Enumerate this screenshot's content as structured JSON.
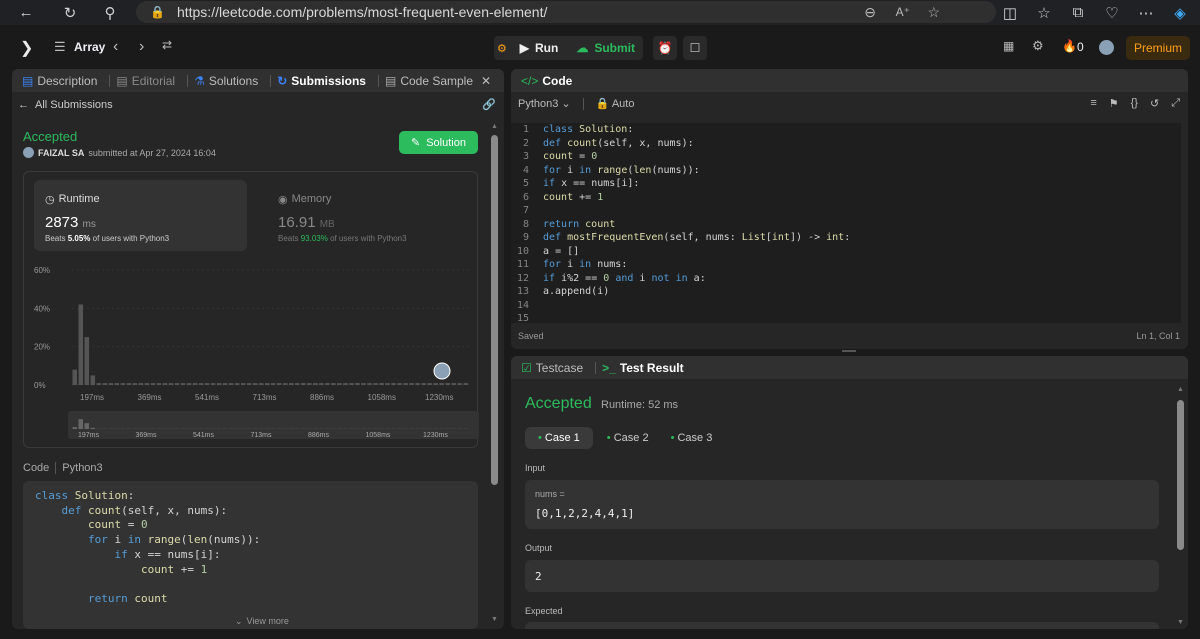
{
  "browser": {
    "url": "https://leetcode.com/problems/most-frequent-even-element/"
  },
  "nav": {
    "problem_list": "Array",
    "run": "Run",
    "submit": "Submit",
    "streak": "0",
    "premium": "Premium"
  },
  "left": {
    "tabs": [
      "Description",
      "Editorial",
      "Solutions",
      "Submissions",
      "Code Sample"
    ],
    "back_label": "All Submissions",
    "status": "Accepted",
    "user": "FAIZAL SA",
    "submitted": "submitted at Apr 27, 2024 16:04",
    "solution_btn": "Solution",
    "runtime": {
      "label": "Runtime",
      "value": "2873",
      "unit": "ms",
      "beats_prefix": "Beats",
      "beats": "5.05%",
      "beats_suffix": "of users with Python3"
    },
    "memory": {
      "label": "Memory",
      "value": "16.91",
      "unit": "MB",
      "beats_prefix": "Beats",
      "beats": "93.03%",
      "beats_suffix": "of users with Python3"
    },
    "code_label": "Code",
    "lang": "Python3",
    "view_more": "View more",
    "code": [
      "class Solution:",
      "    def count(self, x, nums):",
      "        count = 0",
      "        for i in range(len(nums)):",
      "            if x == nums[i]:",
      "                count += 1",
      "",
      "        return count"
    ]
  },
  "chart_data": {
    "type": "bar",
    "title": "",
    "yticks": [
      "60%",
      "40%",
      "20%",
      "0%"
    ],
    "ylim": [
      0,
      60
    ],
    "xticks": [
      "197ms",
      "369ms",
      "541ms",
      "713ms",
      "886ms",
      "1058ms",
      "1230ms"
    ],
    "values": [
      8,
      42,
      25,
      5,
      1,
      1,
      1,
      1,
      1,
      1,
      1,
      1,
      1,
      1,
      1,
      1,
      1,
      1,
      1,
      1,
      1,
      1,
      1,
      1,
      1,
      1,
      1,
      1,
      1,
      1,
      1,
      1,
      1,
      1,
      1,
      1,
      1,
      1,
      1,
      1,
      1,
      1,
      1,
      1,
      1,
      1,
      1,
      1,
      1,
      1,
      1,
      1,
      1,
      1,
      1,
      1,
      1,
      1,
      1,
      1,
      1,
      1,
      1,
      1,
      1,
      1
    ],
    "minimap_xticks": [
      "197ms",
      "369ms",
      "541ms",
      "713ms",
      "886ms",
      "1058ms",
      "1230ms"
    ]
  },
  "editor": {
    "title": "Code",
    "lang": "Python3",
    "auto": "Auto",
    "saved": "Saved",
    "cursor": "Ln 1, Col 1",
    "lines": [
      "class Solution:",
      "    def count(self, x, nums):",
      "        count = 0",
      "        for i in range(len(nums)):",
      "            if x == nums[i]:",
      "                count += 1",
      "",
      "        return count",
      "    def mostFrequentEven(self, nums: List[int]) -> int:",
      "        a = []",
      "        for i in nums:",
      "            if i%2 == 0 and i not in a:",
      "                a.append(i)",
      "",
      ""
    ],
    "line_numbers": [
      "1",
      "2",
      "3",
      "4",
      "5",
      "6",
      "7",
      "8",
      "9",
      "10",
      "11",
      "12",
      "13",
      "14",
      "15"
    ]
  },
  "result": {
    "tab_testcase": "Testcase",
    "tab_result": "Test Result",
    "status": "Accepted",
    "runtime": "Runtime: 52 ms",
    "cases": [
      "Case 1",
      "Case 2",
      "Case 3"
    ],
    "input_label": "Input",
    "input_name": "nums =",
    "input_value": "[0,1,2,2,4,4,1]",
    "output_label": "Output",
    "output_value": "2",
    "expected_label": "Expected"
  },
  "colors": {
    "green": "#2cbb5d",
    "premium": "#ffa116"
  }
}
